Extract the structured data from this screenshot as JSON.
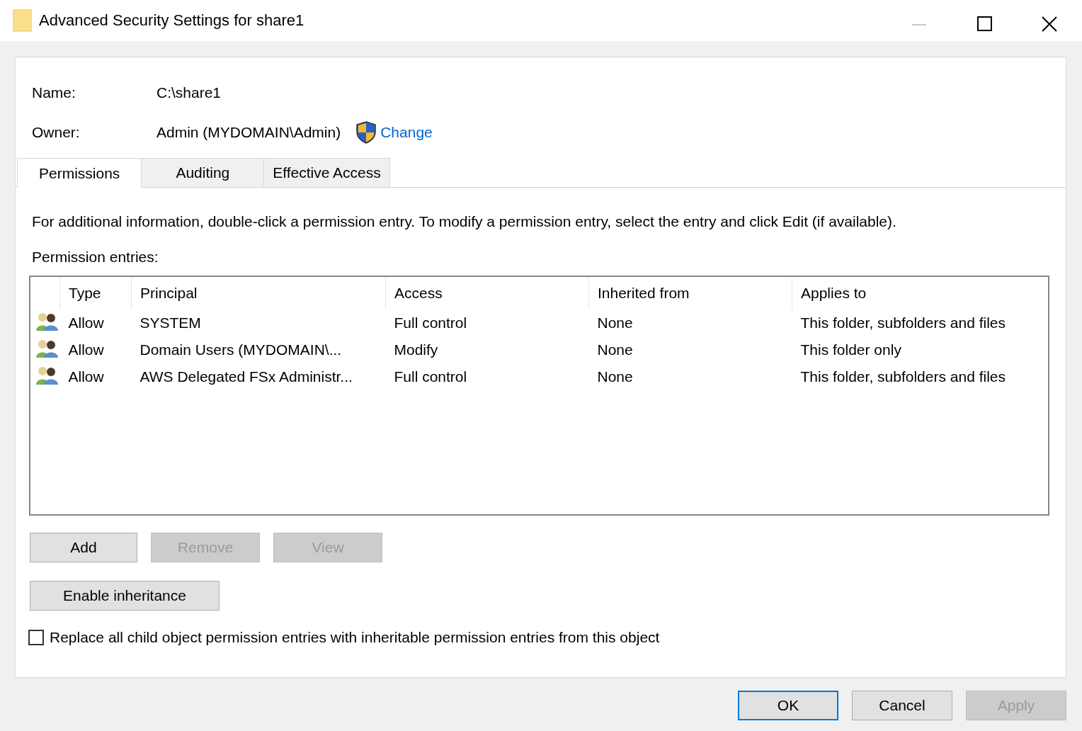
{
  "window": {
    "title": "Advanced Security Settings for share1"
  },
  "name": {
    "label": "Name:",
    "value": "C:\\share1"
  },
  "owner": {
    "label": "Owner:",
    "value": "Admin (MYDOMAIN\\Admin)",
    "link": "Change"
  },
  "tabs": [
    {
      "label": "Permissions",
      "selected": true
    },
    {
      "label": "Auditing",
      "selected": false
    },
    {
      "label": "Effective Access",
      "selected": false
    }
  ],
  "info": "For additional information, double-click a permission entry. To modify a permission entry, select the entry and click Edit (if available).",
  "entries_label": "Permission entries:",
  "table": {
    "columns": [
      "Type",
      "Principal",
      "Access",
      "Inherited from",
      "Applies to"
    ],
    "rows": [
      [
        "Allow",
        "SYSTEM",
        "Full control",
        "None",
        "This folder, subfolders and files"
      ],
      [
        "Allow",
        "Domain Users (MYDOMAIN\\...",
        "Modify",
        "None",
        "This folder only"
      ],
      [
        "Allow",
        "AWS Delegated FSx Administr...",
        "Full control",
        "None",
        "This folder, subfolders and files"
      ]
    ]
  },
  "entry_buttons": [
    {
      "label": "Add",
      "disabled": false
    },
    {
      "label": "Remove",
      "disabled": true
    },
    {
      "label": "View",
      "disabled": true
    }
  ],
  "inheritance_button": "Enable inheritance",
  "replace_checkbox": {
    "label": "Replace all child object permission entries with inheritable permission entries from this object",
    "checked": false
  },
  "dialog_buttons": [
    {
      "label": "OK",
      "disabled": false,
      "default": true
    },
    {
      "label": "Cancel",
      "disabled": false,
      "default": false
    },
    {
      "label": "Apply",
      "disabled": true,
      "default": false
    }
  ]
}
